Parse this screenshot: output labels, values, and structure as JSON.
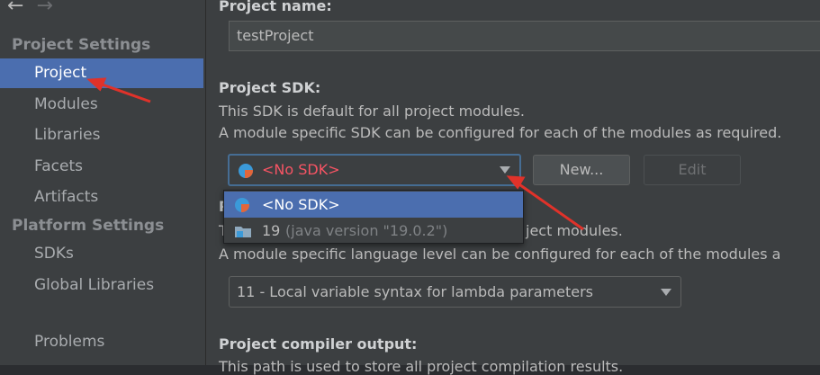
{
  "nav": {
    "back": "←",
    "forward": "→"
  },
  "sidebar": {
    "project_settings_title": "Project Settings",
    "platform_settings_title": "Platform Settings",
    "items": [
      {
        "label": "Project"
      },
      {
        "label": "Modules"
      },
      {
        "label": "Libraries"
      },
      {
        "label": "Facets"
      },
      {
        "label": "Artifacts"
      },
      {
        "label": "SDKs"
      },
      {
        "label": "Global Libraries"
      },
      {
        "label": "Problems"
      }
    ]
  },
  "main": {
    "project_name_label": "Project name:",
    "project_name_value": "testProject",
    "sdk_label": "Project SDK:",
    "sdk_desc1": "This SDK is default for all project modules.",
    "sdk_desc2": "A module specific SDK can be configured for each of the modules as required.",
    "sdk_selected": "<No SDK>",
    "new_button": "New...",
    "edit_button": "Edit",
    "lang_label_partial": "P",
    "lang_desc1_start": "T",
    "lang_desc1_end": "ject modules.",
    "lang_desc2": "A module specific language level can be configured for each of the modules a",
    "lang_level_value": "11 - Local variable syntax for lambda parameters",
    "compiler_label": "Project compiler output:",
    "compiler_desc": "This path is used to store all project compilation results."
  },
  "sdk_popup": {
    "items": [
      {
        "label": "<No SDK>",
        "detail": ""
      },
      {
        "label": "19",
        "detail": "(java version \"19.0.2\")"
      }
    ]
  },
  "colors": {
    "selection": "#4b6eaf",
    "error_text": "#f75464",
    "annotation_arrow": "#e0322a"
  }
}
